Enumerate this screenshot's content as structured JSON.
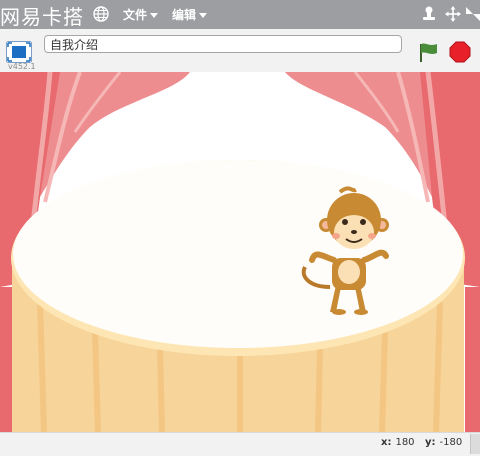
{
  "app": {
    "brand": "网易卡搭",
    "icons": {
      "globe": "globe-icon",
      "stamp": "stamp-icon",
      "move": "move-arrows-icon",
      "shrink": "shrink-icon"
    }
  },
  "menu": {
    "file_label": "文件",
    "edit_label": "编辑"
  },
  "project": {
    "title": "自我介绍",
    "version": "v452.1"
  },
  "controls": {
    "flag": "green-flag-icon",
    "stop": "stop-icon"
  },
  "status": {
    "x_label": "x:",
    "x_value": "180",
    "y_label": "y:",
    "y_value": "-180"
  },
  "colors": {
    "menubar": "#9c9ea2",
    "curtain": "#e86a6e",
    "stage_floor": "#f7d49a",
    "flag": "#4a8d3a",
    "stop": "#e8202a"
  }
}
